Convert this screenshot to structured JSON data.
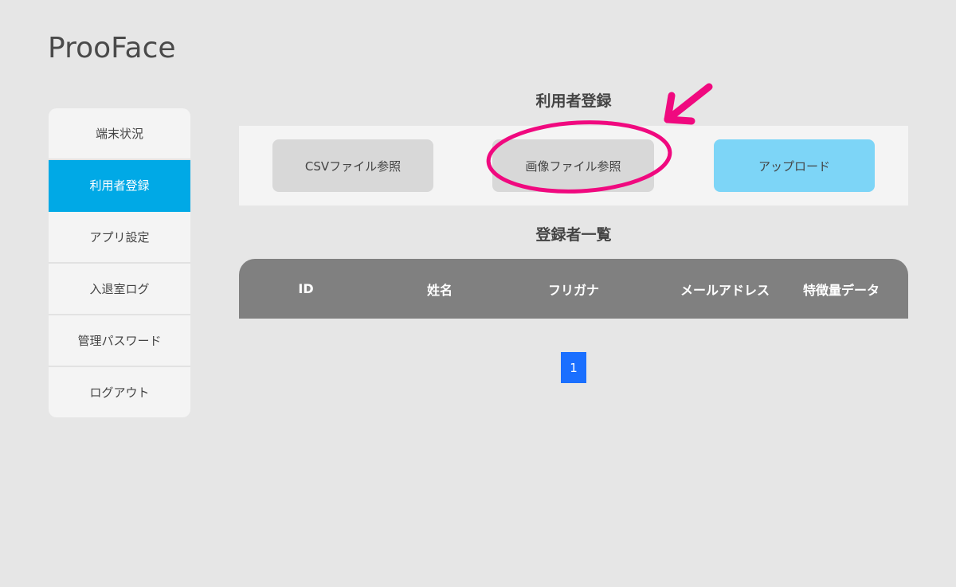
{
  "app": {
    "title": "ProoFace"
  },
  "sidebar": {
    "items": [
      {
        "label": "端末状況",
        "active": false
      },
      {
        "label": "利用者登録",
        "active": true
      },
      {
        "label": "アプリ設定",
        "active": false
      },
      {
        "label": "入退室ログ",
        "active": false
      },
      {
        "label": "管理パスワード",
        "active": false
      },
      {
        "label": "ログアウト",
        "active": false
      }
    ]
  },
  "registration": {
    "title": "利用者登録",
    "csv_button": "CSVファイル参照",
    "image_button": "画像ファイル参照",
    "upload_button": "アップロード"
  },
  "user_list": {
    "title": "登録者一覧",
    "columns": [
      "ID",
      "姓名",
      "フリガナ",
      "メールアドレス",
      "特徴量データ"
    ]
  },
  "pagination": {
    "current": "1"
  },
  "colors": {
    "accent": "#00a9e6",
    "upload_button": "#7dd5f7",
    "page_active": "#1a6fff",
    "annotation": "#f0097f"
  }
}
